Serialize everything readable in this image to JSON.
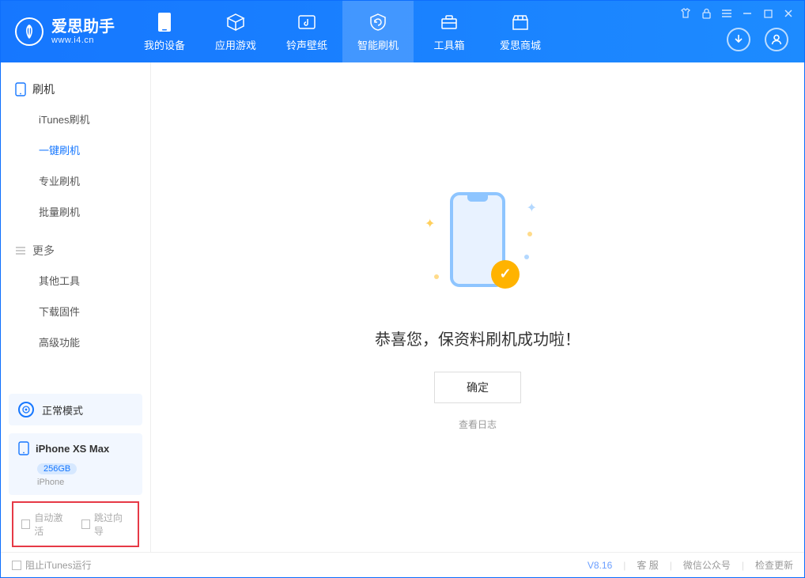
{
  "app": {
    "logo_name": "爱思助手",
    "logo_sub": "www.i4.cn"
  },
  "nav": [
    {
      "label": "我的设备"
    },
    {
      "label": "应用游戏"
    },
    {
      "label": "铃声壁纸"
    },
    {
      "label": "智能刷机"
    },
    {
      "label": "工具箱"
    },
    {
      "label": "爱思商城"
    }
  ],
  "sidebar": {
    "section1_title": "刷机",
    "items1": [
      {
        "label": "iTunes刷机"
      },
      {
        "label": "一键刷机"
      },
      {
        "label": "专业刷机"
      },
      {
        "label": "批量刷机"
      }
    ],
    "section2_title": "更多",
    "items2": [
      {
        "label": "其他工具"
      },
      {
        "label": "下载固件"
      },
      {
        "label": "高级功能"
      }
    ],
    "mode_label": "正常模式",
    "device": {
      "name": "iPhone XS Max",
      "storage": "256GB",
      "type": "iPhone"
    },
    "auto_activate": "自动激活",
    "skip_guide": "跳过向导"
  },
  "main": {
    "success_title": "恭喜您，保资料刷机成功啦！",
    "ok_button": "确定",
    "view_log": "查看日志"
  },
  "footer": {
    "block_itunes": "阻止iTunes运行",
    "version": "V8.16",
    "service": "客 服",
    "wechat": "微信公众号",
    "check_update": "检查更新"
  }
}
